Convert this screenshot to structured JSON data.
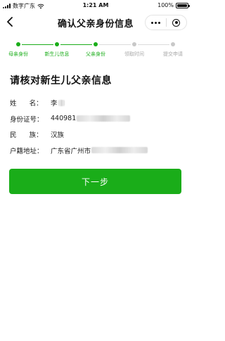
{
  "status_bar": {
    "carrier": "数字广东",
    "time": "1:21 AM",
    "battery_text": "100%",
    "battery_level": 1.0
  },
  "nav": {
    "title": "确认父亲身份信息",
    "back_icon": "chevron-left-icon",
    "more_icon": "more-dots-icon",
    "close_icon": "target-circle-icon"
  },
  "stepper": {
    "active_color": "#1aad19",
    "inactive_color": "#c8c8c8",
    "steps": [
      {
        "label": "母亲身份",
        "done": true
      },
      {
        "label": "新生儿信息",
        "done": true
      },
      {
        "label": "父亲身份",
        "done": true
      },
      {
        "label": "领取时间",
        "done": false
      },
      {
        "label": "提交申请",
        "done": false
      }
    ]
  },
  "section": {
    "title": "请核对新生儿父亲信息"
  },
  "info": {
    "name": {
      "label": "姓      名：",
      "value": "李"
    },
    "id_number": {
      "label": "身份证号：",
      "value": "440981"
    },
    "ethnicity": {
      "label": "民      族：",
      "value": "汉族"
    },
    "household": {
      "label": "户籍地址：",
      "value": "广东省广州市"
    }
  },
  "actions": {
    "next_label": "下一步",
    "accent": "#1aad19"
  }
}
